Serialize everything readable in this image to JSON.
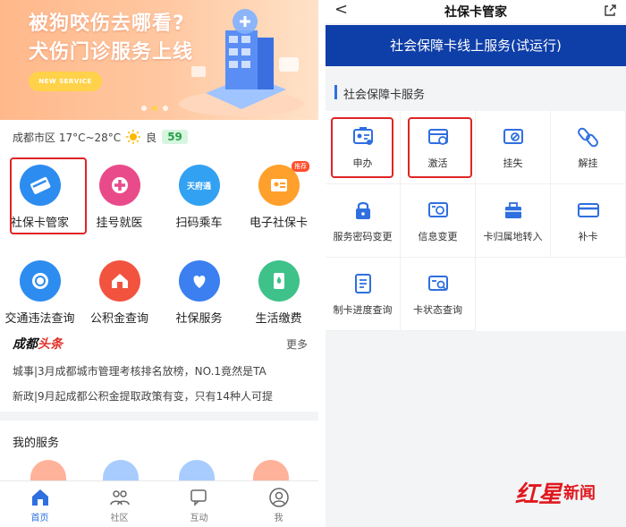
{
  "left": {
    "banner": {
      "title_line1": "被狗咬伤去哪看?",
      "title_line2": "犬伤门诊服务上线",
      "button_label": "NEW SERVICE"
    },
    "weather": {
      "location_temp": "成都市区 17°C~28°C",
      "quality": "良",
      "aqi": "59"
    },
    "grid_row1": [
      {
        "label": "社保卡管家",
        "icon": "card-icon",
        "color": "#2d8cf0"
      },
      {
        "label": "挂号就医",
        "icon": "medical-icon",
        "color": "#e94b8a"
      },
      {
        "label": "扫码乘车",
        "icon": "transit-icon",
        "color": "#33a1f2",
        "icon_text": "天府通"
      },
      {
        "label": "电子社保卡",
        "icon": "ecard-icon",
        "color": "#ffa02c",
        "badge": "推荐"
      }
    ],
    "grid_row2": [
      {
        "label": "交通违法查询",
        "icon": "traffic-icon",
        "color": "#2d8cf0"
      },
      {
        "label": "公积金查询",
        "icon": "fund-icon",
        "color": "#f2533f"
      },
      {
        "label": "社保服务",
        "icon": "social-icon",
        "color": "#3b7ff0"
      },
      {
        "label": "生活缴费",
        "icon": "utility-icon",
        "color": "#3ec28a"
      }
    ],
    "news": {
      "brand_a": "成都",
      "brand_b": "头条",
      "more": "更多",
      "items": [
        "城事|3月成都城市管理考核排名放榜，NO.1竟然是TA",
        "新政|9月起成都公积金提取政策有变，只有14种人可提"
      ]
    },
    "my_services_title": "我的服务",
    "tabs": [
      {
        "label": "首页",
        "icon": "home-icon"
      },
      {
        "label": "社区",
        "icon": "community-icon"
      },
      {
        "label": "互动",
        "icon": "chat-icon"
      },
      {
        "label": "我",
        "icon": "user-icon"
      }
    ]
  },
  "right": {
    "back": "<",
    "title": "社保卡管家",
    "banner": "社会保障卡线上服务(试运行)",
    "section": "社会保障卡服务",
    "services": [
      {
        "label": "申办",
        "icon": "apply-icon"
      },
      {
        "label": "激活",
        "icon": "activate-icon"
      },
      {
        "label": "挂失",
        "icon": "report-loss-icon"
      },
      {
        "label": "解挂",
        "icon": "unlink-icon"
      },
      {
        "label": "服务密码变更",
        "icon": "lock-icon"
      },
      {
        "label": "信息变更",
        "icon": "info-change-icon"
      },
      {
        "label": "卡归属地转入",
        "icon": "transfer-icon"
      },
      {
        "label": "补卡",
        "icon": "reissue-card-icon"
      },
      {
        "label": "制卡进度查询",
        "icon": "progress-icon"
      },
      {
        "label": "卡状态查询",
        "icon": "status-query-icon"
      }
    ]
  },
  "watermark": {
    "a": "红星",
    "b": "新闻"
  },
  "colors": {
    "accent_blue": "#2f6fe0",
    "navy": "#0e3ea8",
    "highlight_red": "#e02424"
  }
}
